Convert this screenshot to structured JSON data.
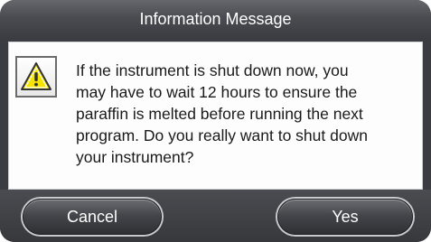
{
  "dialog": {
    "title": "Information Message",
    "icon": "warning-triangle-icon",
    "message": "If the instrument is shut down now, you\nmay have to wait 12 hours to ensure the\nparaffin is melted before running the next\nprogram. Do you really want to shut down\nyour instrument?",
    "buttons": {
      "cancel_label": "Cancel",
      "yes_label": "Yes"
    }
  },
  "colors": {
    "frame": "#3a3c41",
    "body_background": "#fdfdfd",
    "warning_fill": "#f5e400",
    "text": "#1a1a1a"
  }
}
